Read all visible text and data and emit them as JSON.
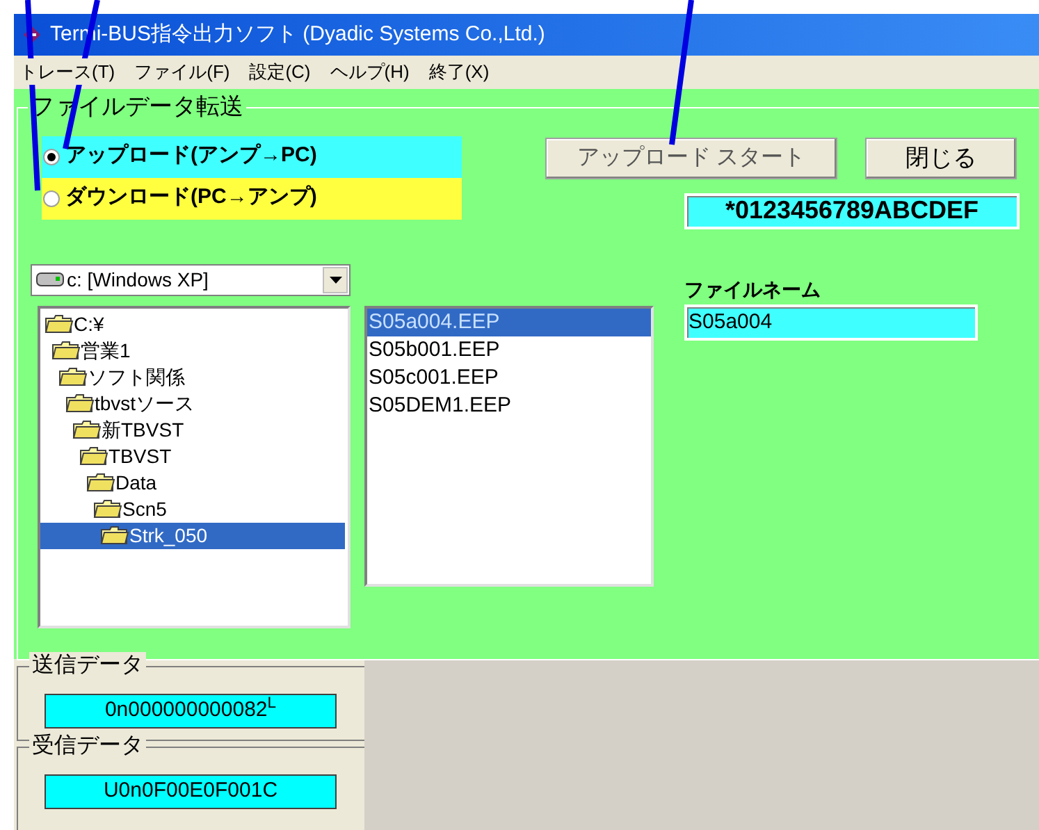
{
  "window": {
    "title": "Termi-BUS指令出力ソフト (Dyadic Systems Co.,Ltd.)"
  },
  "menu": [
    "トレース(T)",
    "ファイル(F)",
    "設定(C)",
    "ヘルプ(H)",
    "終了(X)"
  ],
  "transfer_group": {
    "title": "ファイルデータ転送",
    "modes": [
      {
        "label": "アップロード(アンプ→PC)",
        "selected": true,
        "color": "#40ffff"
      },
      {
        "label": "ダウンロード(PC→アンプ)",
        "selected": false,
        "color": "#ffff40"
      }
    ],
    "start_button": {
      "label": "アップロード スタート",
      "disabled": true
    },
    "close_button": {
      "label": "閉じる"
    },
    "hex_display": "*0123456789ABCDEF",
    "drive_select": "c: [Windows XP]",
    "folders": [
      {
        "name": "C:¥",
        "selected": false,
        "children": [
          {
            "name": "営業1",
            "selected": false,
            "children": [
              {
                "name": "ソフト関係",
                "selected": false,
                "children": [
                  {
                    "name": "tbvstソース",
                    "selected": false,
                    "children": [
                      {
                        "name": "新TBVST",
                        "selected": false,
                        "children": [
                          {
                            "name": "TBVST",
                            "selected": false,
                            "children": [
                              {
                                "name": "Data",
                                "selected": false,
                                "children": [
                                  {
                                    "name": "Scn5",
                                    "selected": false,
                                    "children": [
                                      {
                                        "name": "Strk_050",
                                        "selected": true
                                      }
                                    ]
                                  }
                                ]
                              }
                            ]
                          }
                        ]
                      }
                    ]
                  }
                ]
              }
            ]
          }
        ]
      }
    ],
    "files": [
      {
        "name": "S05a004.EEP",
        "selected": true
      },
      {
        "name": "S05b001.EEP",
        "selected": false
      },
      {
        "name": "S05c001.EEP",
        "selected": false
      },
      {
        "name": "S05DEM1.EEP",
        "selected": false
      }
    ],
    "filename": {
      "label": "ファイルネーム",
      "value": "S05a004"
    }
  },
  "send_data": {
    "title": "送信データ",
    "value": "0n000000000082$^{L}$"
  },
  "receive_data": {
    "title": "受信データ",
    "value": "U0n0F00E0F001C"
  }
}
